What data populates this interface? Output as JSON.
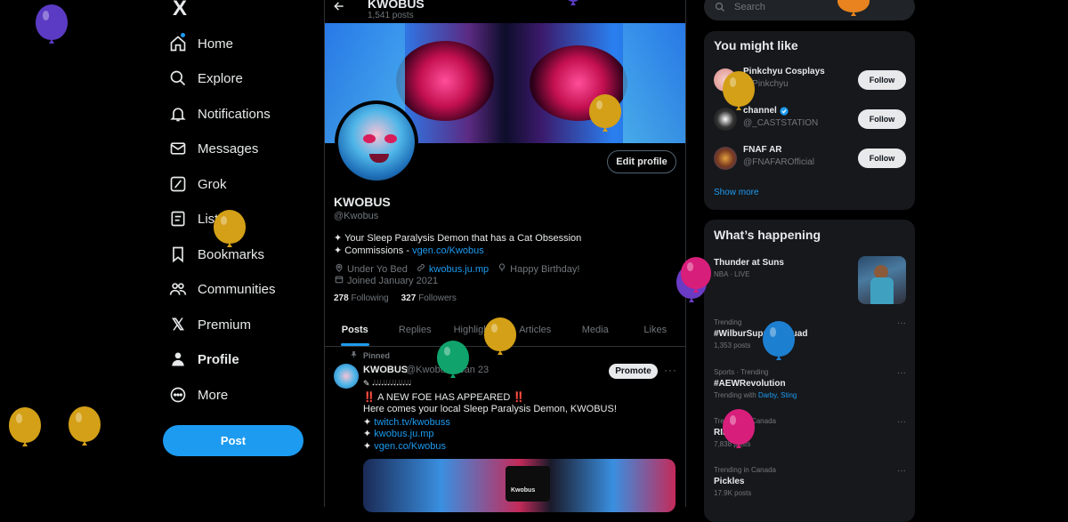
{
  "nav": {
    "logo": "X",
    "items": [
      {
        "label": "Home",
        "icon": "home-icon"
      },
      {
        "label": "Explore",
        "icon": "search-icon"
      },
      {
        "label": "Notifications",
        "icon": "bell-icon"
      },
      {
        "label": "Messages",
        "icon": "mail-icon"
      },
      {
        "label": "Grok",
        "icon": "grok-icon"
      },
      {
        "label": "Lists",
        "icon": "list-icon"
      },
      {
        "label": "Bookmarks",
        "icon": "bookmark-icon"
      },
      {
        "label": "Communities",
        "icon": "people-icon"
      },
      {
        "label": "Premium",
        "icon": "x-logo-icon"
      },
      {
        "label": "Profile",
        "icon": "person-icon"
      },
      {
        "label": "More",
        "icon": "more-circle-icon"
      }
    ],
    "post_button": "Post"
  },
  "header": {
    "name": "KWOBUS",
    "posts_count": "1,541 posts"
  },
  "profile": {
    "edit_button": "Edit profile",
    "name": "KWOBUS",
    "handle": "@Kwobus",
    "bio_line1": "✦ Your Sleep Paralysis Demon that has a Cat Obsession",
    "bio_line2_prefix": "✦ Commissions - ",
    "bio_line2_link": "vgen.co/Kwobus",
    "location": "Under Yo Bed",
    "website": "kwobus.ju.mp",
    "birthday": "Happy Birthday!",
    "joined": "Joined January 2021",
    "following_count": "278",
    "following_label": "Following",
    "followers_count": "327",
    "followers_label": "Followers"
  },
  "tabs": [
    {
      "label": "Posts",
      "active": true
    },
    {
      "label": "Replies",
      "active": false
    },
    {
      "label": "Highlights",
      "active": false
    },
    {
      "label": "Articles",
      "active": false
    },
    {
      "label": "Media",
      "active": false
    },
    {
      "label": "Likes",
      "active": false
    }
  ],
  "pinned_post": {
    "pinned_label": "Pinned",
    "author": "KWOBUS",
    "handle_date": "@Kwobus · Jan 23",
    "promote_button": "Promote",
    "more": "···",
    "line0": "✎ 𝆺𝅥𝆺𝅥𝆺𝅥𝆺𝅥𝆺𝅥𝆺𝅥𝆺𝅥𝆺𝅥𝆺𝅥𝆺𝅥𝆺𝅥𝆺𝅥𝆺𝅥",
    "line1": "‼️ A NEW FOE HAS APPEARED ‼️",
    "line2": "Here comes your local Sleep Paralysis Demon, KWOBUS!",
    "link1": "twitch.tv/kwobuss",
    "link2": "kwobus.ju.mp",
    "link3": "vgen.co/Kwobus",
    "image_caption": "Kwobus"
  },
  "search": {
    "placeholder": "Search"
  },
  "you_might_like": {
    "title": "You might like",
    "accounts": [
      {
        "name": "Pinkchyu Cosplays",
        "handle": "@Pinkchyu",
        "verified": false,
        "follow": "Follow"
      },
      {
        "name": "channel",
        "handle": "@_CASTSTATION",
        "verified": true,
        "follow": "Follow"
      },
      {
        "name": "FNAF AR",
        "handle": "@FNAFAROfficial",
        "verified": false,
        "follow": "Follow"
      }
    ],
    "show_more": "Show more"
  },
  "whats_happening": {
    "title": "What’s happening",
    "featured": {
      "title": "Thunder at Suns",
      "context": "NBA · LIVE"
    },
    "trends": [
      {
        "context": "Trending",
        "title": "#WilburSupportSquad",
        "count": "1,353 posts"
      },
      {
        "context": "Sports · Trending",
        "title": "#AEWRevolution",
        "count_prefix": "Trending with ",
        "count_links": "Darby, Sting"
      },
      {
        "context": "Trending in Canada",
        "title": "RIP Mort",
        "count": "7,838 posts"
      },
      {
        "context": "Trending in Canada",
        "title": "Pickles",
        "count": "17.9K posts"
      }
    ]
  },
  "colors": {
    "accent": "#1d9bf0",
    "background": "#000000",
    "card": "#16181c",
    "muted_text": "#71767b"
  }
}
